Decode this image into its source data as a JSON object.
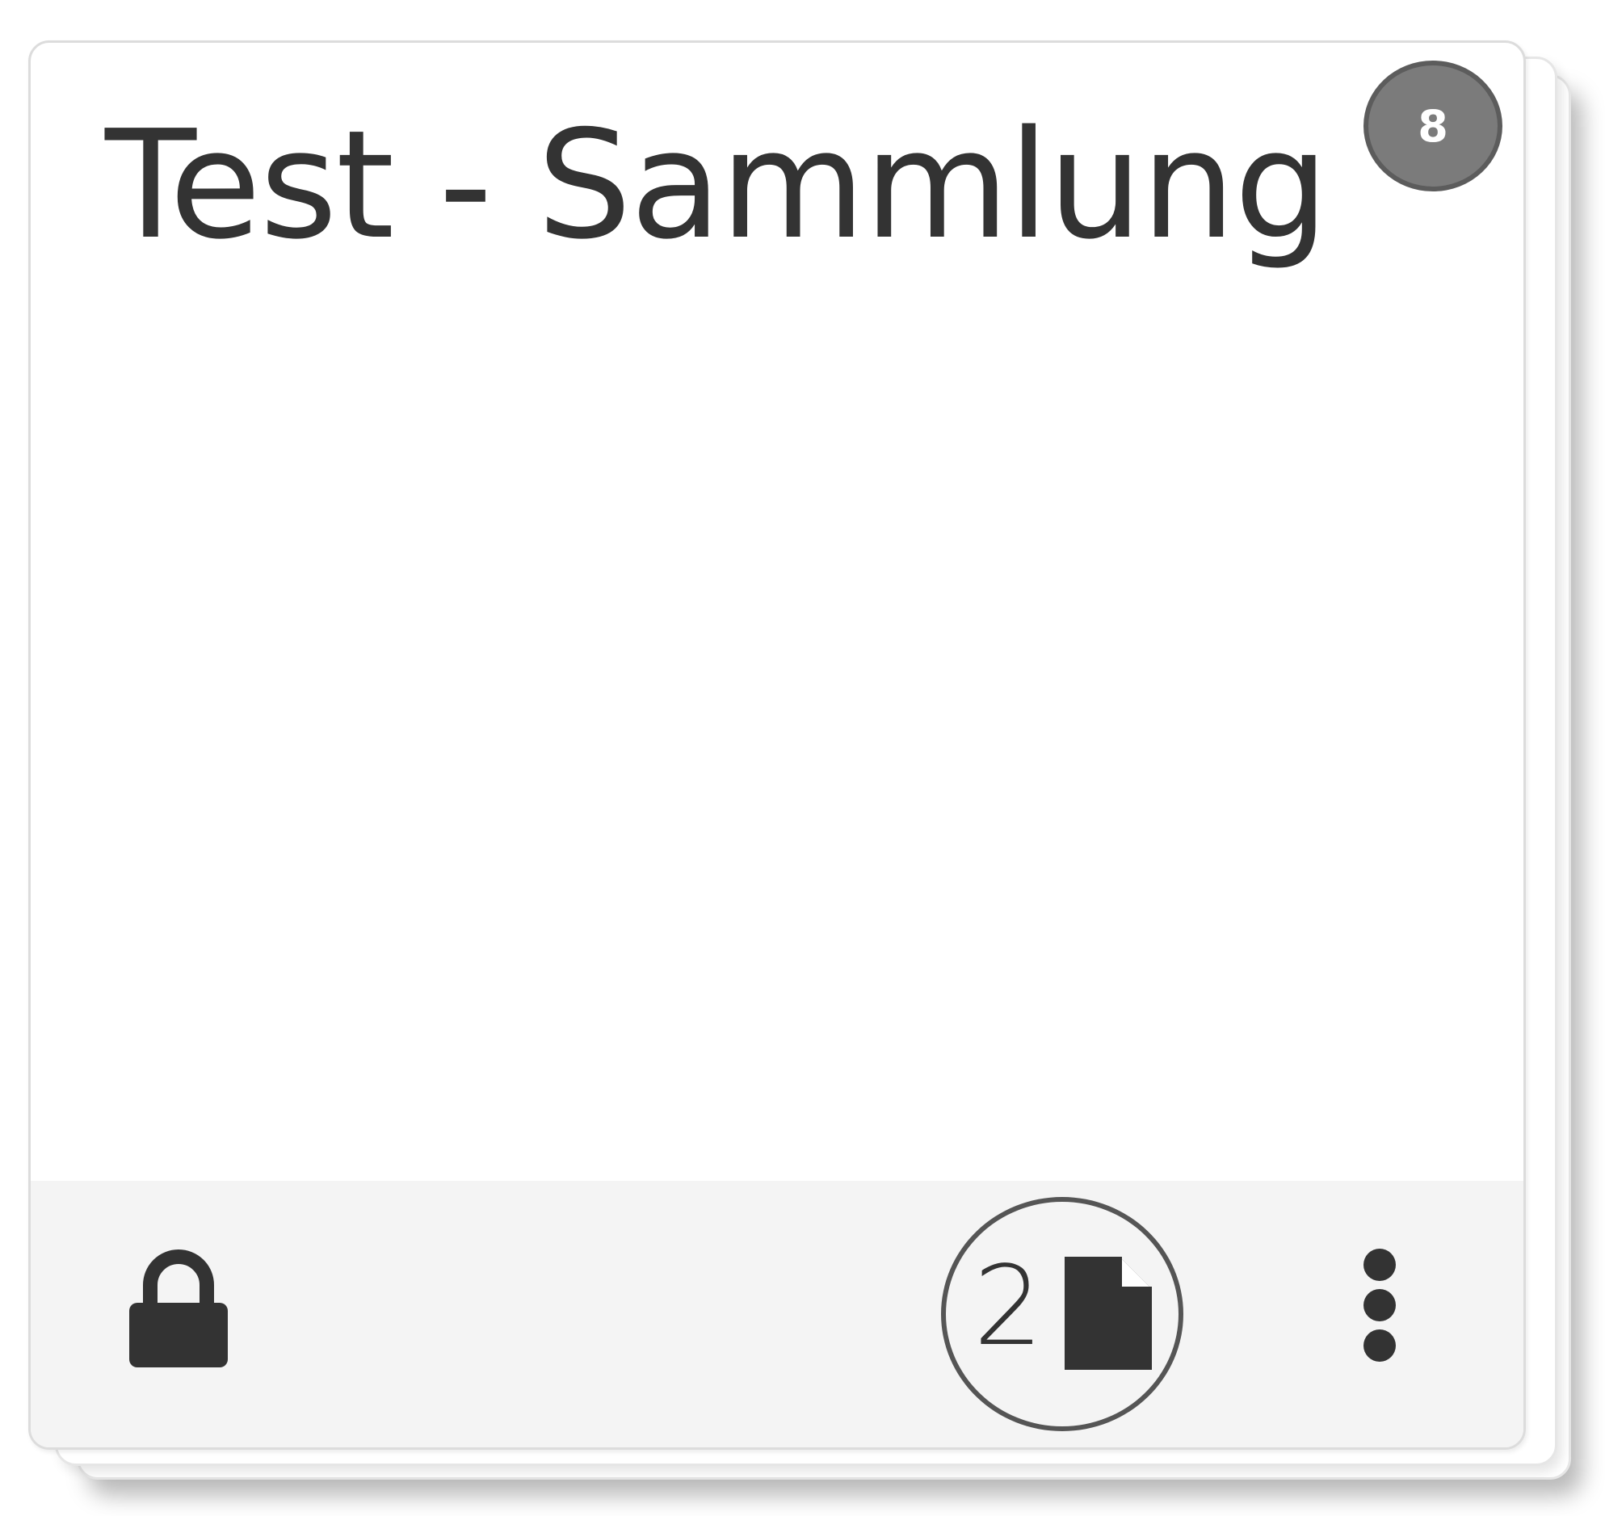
{
  "card": {
    "title": "Test - Sammlung",
    "item_count_badge": "8",
    "footer": {
      "document_count": "2",
      "icons": {
        "lock": "lock-icon",
        "document": "document-icon",
        "more": "kebab-menu-icon"
      }
    }
  },
  "colors": {
    "text": "#333333",
    "badge_fill": "#7b7b7b",
    "badge_border": "#5c5c5c",
    "footer_bg": "#f4f4f4",
    "card_border": "#dcdcdc"
  }
}
